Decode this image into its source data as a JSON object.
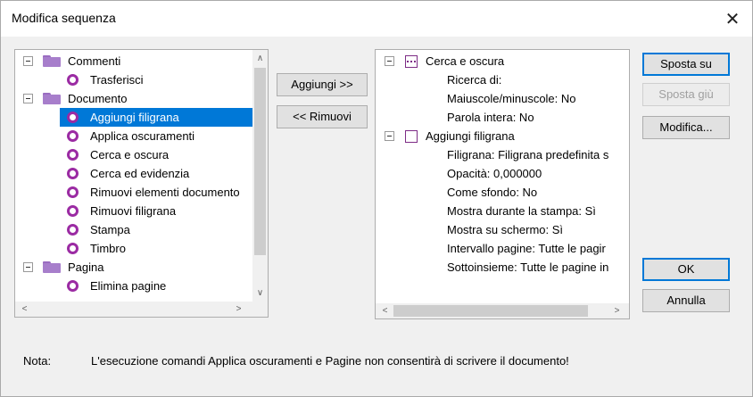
{
  "window": {
    "title": "Modifica sequenza",
    "close_glyph": "✕"
  },
  "left_tree": {
    "items": [
      {
        "label": "Commenti",
        "kind": "folder",
        "expanded": true
      },
      {
        "label": "Trasferisci",
        "kind": "command"
      },
      {
        "label": "Documento",
        "kind": "folder",
        "expanded": true
      },
      {
        "label": "Aggiungi filigrana",
        "kind": "command",
        "selected": true
      },
      {
        "label": "Applica oscuramenti",
        "kind": "command"
      },
      {
        "label": "Cerca e oscura",
        "kind": "command"
      },
      {
        "label": "Cerca ed evidenzia",
        "kind": "command"
      },
      {
        "label": "Rimuovi elementi documento",
        "kind": "command"
      },
      {
        "label": "Rimuovi filigrana",
        "kind": "command"
      },
      {
        "label": "Stampa",
        "kind": "command"
      },
      {
        "label": "Timbro",
        "kind": "command"
      },
      {
        "label": "Pagina",
        "kind": "folder",
        "expanded": true
      },
      {
        "label": "Elimina pagine",
        "kind": "command"
      }
    ]
  },
  "middle_buttons": {
    "add": "Aggiungi >>",
    "remove": "<< Rimuovi"
  },
  "right_tree": {
    "items": [
      {
        "label": "Cerca e oscura",
        "kind": "step",
        "icon": "redact-icon"
      },
      {
        "label": "Ricerca di:",
        "kind": "prop"
      },
      {
        "label": "Maiuscole/minuscole: No",
        "kind": "prop"
      },
      {
        "label": "Parola intera: No",
        "kind": "prop"
      },
      {
        "label": "Aggiungi filigrana",
        "kind": "step",
        "icon": "checkbox-icon"
      },
      {
        "label": "Filigrana: Filigrana predefinita s",
        "kind": "prop"
      },
      {
        "label": "Opacità: 0,000000",
        "kind": "prop"
      },
      {
        "label": "Come sfondo: No",
        "kind": "prop"
      },
      {
        "label": "Mostra durante la stampa: Sì",
        "kind": "prop"
      },
      {
        "label": "Mostra su schermo: Sì",
        "kind": "prop"
      },
      {
        "label": "Intervallo pagine: Tutte le pagir",
        "kind": "prop"
      },
      {
        "label": "Sottoinsieme: Tutte le pagine in",
        "kind": "prop"
      }
    ]
  },
  "side_buttons": {
    "move_up": "Sposta su",
    "move_down": "Sposta giù",
    "edit": "Modifica...",
    "ok": "OK",
    "cancel": "Annulla"
  },
  "note": {
    "label": "Nota:",
    "text": "L'esecuzione comandi Applica oscuramenti e Pagine non consentirà di scrivere il documento!"
  },
  "scroll": {
    "up": "∧",
    "down": "∨",
    "left": "<",
    "right": ">"
  },
  "colors": {
    "accent": "#0078d7",
    "folder": "#a77ecb",
    "command_ring": "#9b2ba3"
  }
}
